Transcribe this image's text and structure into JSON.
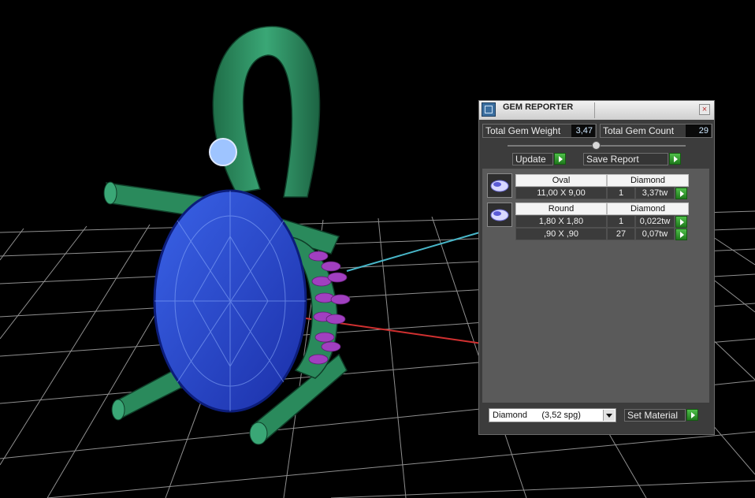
{
  "panel": {
    "title": "GEM REPORTER",
    "close_glyph": "×",
    "total_weight": {
      "label": "Total Gem Weight",
      "value": "3,47"
    },
    "total_count": {
      "label": "Total Gem Count",
      "value": "29"
    },
    "update_label": "Update",
    "save_label": "Save Report",
    "groups": [
      {
        "shape": "Oval",
        "material": "Diamond",
        "rows": [
          {
            "size": "11,00 X 9,00",
            "count": "1",
            "weight": "3,37tw"
          }
        ]
      },
      {
        "shape": "Round",
        "material": "Diamond",
        "rows": [
          {
            "size": "1,80 X 1,80",
            "count": "1",
            "weight": "0,022tw"
          },
          {
            "size": ",90 X ,90",
            "count": "27",
            "weight": "0,07tw"
          }
        ]
      }
    ],
    "material_select": {
      "value": "Diamond      (3,52 spg)"
    },
    "set_material_label": "Set Material"
  },
  "icons": {
    "app": "gem-reporter-app-icon",
    "go": "green-play-arrow-icon",
    "dropdown": "dropdown-arrow-icon",
    "thumb_oval": "oval-gem-icon",
    "thumb_round": "round-gem-icon"
  },
  "colors": {
    "background": "#000000",
    "grid": "#cfcfcf",
    "model_green": "#2e8a5e",
    "gem_blue": "#2f4fd6",
    "accent_stones": "#a13fc0",
    "axis_x": "#d03030",
    "axis_z": "#48b6c8"
  }
}
